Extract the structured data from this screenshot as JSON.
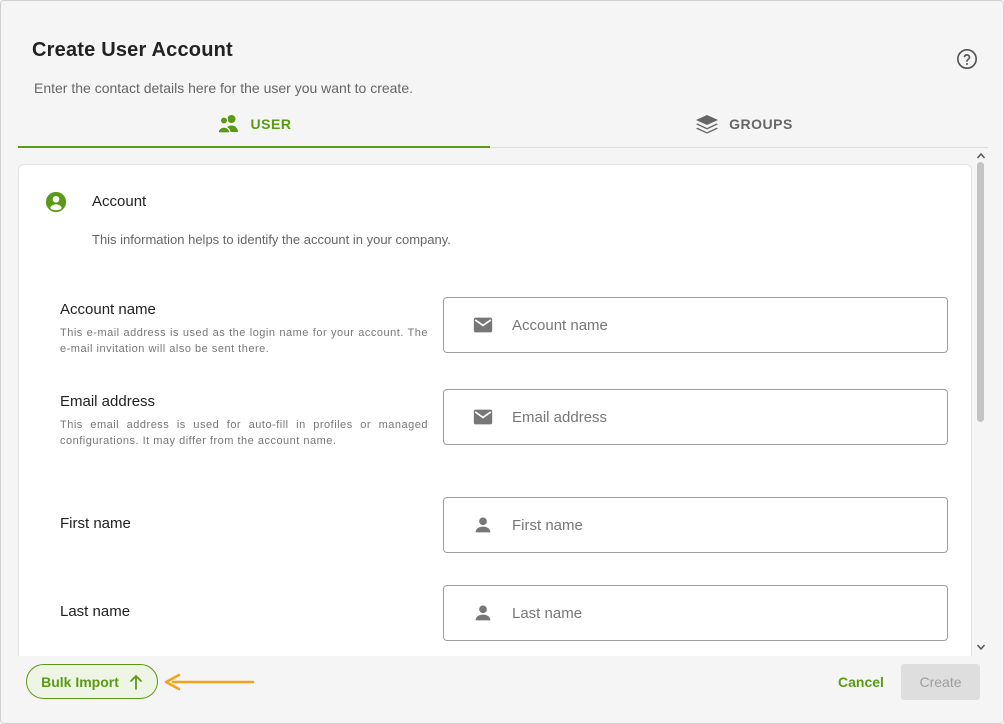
{
  "dialog": {
    "title": "Create User Account",
    "subtitle": "Enter the contact details here for the user you want to create.",
    "help_icon": "help-circle-icon"
  },
  "tabs": [
    {
      "label": "USER",
      "icon": "users-icon",
      "active": true
    },
    {
      "label": "GROUPS",
      "icon": "layers-icon",
      "active": false
    }
  ],
  "section": {
    "icon": "account-circle-icon",
    "title": "Account",
    "description": "This information helps to identify the account in your company."
  },
  "fields": [
    {
      "label": "Account name",
      "hint": "This e-mail address is used as the login name for your account. The e-mail invitation will also be sent there.",
      "placeholder": "Account name",
      "value": "",
      "icon": "mail-icon"
    },
    {
      "label": "Email address",
      "hint": "This email address is used for auto-fill in profiles or managed configurations. It may differ from the account name.",
      "placeholder": "Email address",
      "value": "",
      "icon": "mail-icon"
    },
    {
      "label": "First name",
      "hint": "",
      "placeholder": "First name",
      "value": "",
      "icon": "person-icon"
    },
    {
      "label": "Last name",
      "hint": "",
      "placeholder": "Last name",
      "value": "",
      "icon": "person-icon"
    }
  ],
  "footer": {
    "bulk_import_label": "Bulk Import",
    "cancel_label": "Cancel",
    "create_label": "Create"
  },
  "colors": {
    "accent": "#5b9a16",
    "annotation_arrow": "#f5a21b",
    "disabled_bg": "#dedede"
  }
}
